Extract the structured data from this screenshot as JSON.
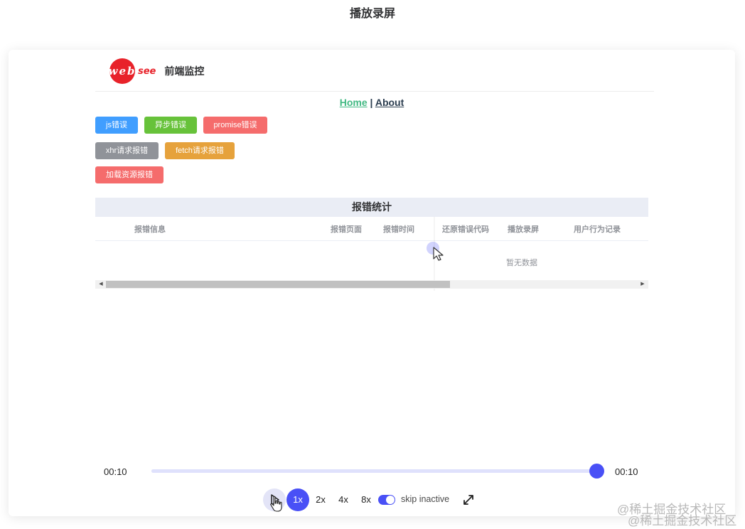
{
  "dialog": {
    "title": "播放录屏"
  },
  "app": {
    "logo_text": "web",
    "logo_suffix": "see",
    "name": "前端监控"
  },
  "nav": {
    "home": "Home",
    "separator": "|",
    "about": "About"
  },
  "buttons": [
    {
      "label": "js错误",
      "type": "primary"
    },
    {
      "label": "异步错误",
      "type": "success"
    },
    {
      "label": "promise错误",
      "type": "danger"
    },
    {
      "label": "xhr请求报错",
      "type": "info"
    },
    {
      "label": "fetch请求报错",
      "type": "warning"
    },
    {
      "label": "加载资源报错",
      "type": "danger"
    }
  ],
  "table": {
    "title": "报错统计",
    "columns": [
      "报错信息",
      "报错页面",
      "报错时间",
      "还原错误代码",
      "播放录屏",
      "用户行为记录"
    ],
    "empty_text": "暂无数据"
  },
  "player": {
    "current_time": "00:10",
    "total_time": "00:10",
    "progress": 1.0,
    "speeds": [
      "1x",
      "2x",
      "4x",
      "8x"
    ],
    "active_speed": "1x",
    "skip_inactive_label": "skip inactive",
    "skip_inactive_on": true
  },
  "watermark": "@稀土掘金技术社区",
  "colors": {
    "accent": "#4950f6",
    "nav_active": "#42b983",
    "primary": "#409eff",
    "success": "#67c23a",
    "danger": "#f56c6c",
    "info": "#909399",
    "warning": "#e6a23c"
  }
}
